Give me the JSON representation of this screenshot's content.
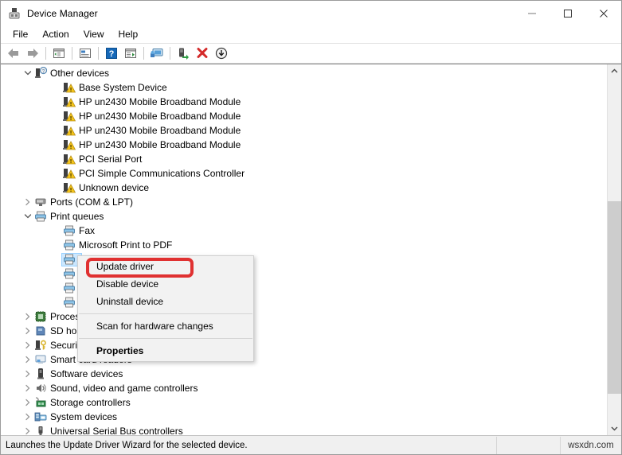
{
  "window": {
    "title": "Device Manager",
    "icon": "device-manager-icon",
    "controls": {
      "minimize": "minimize-icon",
      "maximize": "maximize-icon",
      "close": "close-icon"
    }
  },
  "menubar": {
    "items": [
      {
        "label": "File"
      },
      {
        "label": "Action"
      },
      {
        "label": "View"
      },
      {
        "label": "Help"
      }
    ]
  },
  "toolbar": {
    "buttons": [
      {
        "name": "back-icon",
        "tip": "Back"
      },
      {
        "name": "forward-icon",
        "tip": "Forward"
      },
      {
        "name": "show-hide-console-tree-icon",
        "tip": "Show/Hide Console Tree"
      },
      {
        "name": "properties-icon",
        "tip": "Properties"
      },
      {
        "name": "help-icon",
        "tip": "Help"
      },
      {
        "name": "update-driver-icon",
        "tip": "Update driver"
      },
      {
        "name": "scan-for-hardware-changes-icon",
        "tip": "Scan for hardware changes"
      },
      {
        "name": "enable-device-icon",
        "tip": "Enable device"
      },
      {
        "name": "uninstall-device-icon",
        "tip": "Uninstall device"
      },
      {
        "name": "disable-device-icon",
        "tip": "Disable device"
      }
    ]
  },
  "tree": {
    "rows": [
      {
        "label": "Other devices",
        "icon": "unknown-device-category-icon",
        "level": 1,
        "expander": "expanded",
        "selected": false
      },
      {
        "label": "Base System Device",
        "icon": "warning-device-icon",
        "level": 2,
        "expander": "none",
        "selected": false
      },
      {
        "label": "HP un2430 Mobile Broadband Module",
        "icon": "warning-device-icon",
        "level": 2,
        "expander": "none",
        "selected": false
      },
      {
        "label": "HP un2430 Mobile Broadband Module",
        "icon": "warning-device-icon",
        "level": 2,
        "expander": "none",
        "selected": false
      },
      {
        "label": "HP un2430 Mobile Broadband Module",
        "icon": "warning-device-icon",
        "level": 2,
        "expander": "none",
        "selected": false
      },
      {
        "label": "HP un2430 Mobile Broadband Module",
        "icon": "warning-device-icon",
        "level": 2,
        "expander": "none",
        "selected": false
      },
      {
        "label": "PCI Serial Port",
        "icon": "warning-device-icon",
        "level": 2,
        "expander": "none",
        "selected": false
      },
      {
        "label": "PCI Simple Communications Controller",
        "icon": "warning-device-icon",
        "level": 2,
        "expander": "none",
        "selected": false
      },
      {
        "label": "Unknown device",
        "icon": "warning-device-icon",
        "level": 2,
        "expander": "none",
        "selected": false
      },
      {
        "label": "Ports (COM & LPT)",
        "icon": "ports-icon",
        "level": 1,
        "expander": "collapsed",
        "selected": false
      },
      {
        "label": "Print queues",
        "icon": "printer-icon",
        "level": 1,
        "expander": "expanded",
        "selected": false
      },
      {
        "label": "Fax",
        "icon": "printer-icon",
        "level": 2,
        "expander": "none",
        "selected": false
      },
      {
        "label": "Microsoft Print to PDF",
        "icon": "printer-icon",
        "level": 2,
        "expander": "none",
        "selected": false
      },
      {
        "label": "",
        "icon": "printer-icon",
        "level": 2,
        "expander": "none",
        "selected": true
      },
      {
        "label": "",
        "icon": "printer-icon",
        "level": 2,
        "expander": "none",
        "selected": false
      },
      {
        "label": "",
        "icon": "printer-icon",
        "level": 2,
        "expander": "none",
        "selected": false
      },
      {
        "label": "",
        "icon": "printer-icon",
        "level": 2,
        "expander": "none",
        "selected": false
      },
      {
        "label": "Processors",
        "icon": "processor-icon",
        "level": 1,
        "expander": "collapsed",
        "selected": false
      },
      {
        "label": "SD host adapters",
        "icon": "sd-host-adapter-icon",
        "level": 1,
        "expander": "collapsed",
        "selected": false
      },
      {
        "label": "Security devices",
        "icon": "security-device-icon",
        "level": 1,
        "expander": "collapsed",
        "selected": false
      },
      {
        "label": "Smart card readers",
        "icon": "smart-card-reader-icon",
        "level": 1,
        "expander": "collapsed",
        "selected": false
      },
      {
        "label": "Software devices",
        "icon": "software-device-icon",
        "level": 1,
        "expander": "collapsed",
        "selected": false
      },
      {
        "label": "Sound, video and game controllers",
        "icon": "sound-controller-icon",
        "level": 1,
        "expander": "collapsed",
        "selected": false
      },
      {
        "label": "Storage controllers",
        "icon": "storage-controller-icon",
        "level": 1,
        "expander": "collapsed",
        "selected": false
      },
      {
        "label": "System devices",
        "icon": "system-device-icon",
        "level": 1,
        "expander": "collapsed",
        "selected": false
      },
      {
        "label": "Universal Serial Bus controllers",
        "icon": "usb-controller-icon",
        "level": 1,
        "expander": "collapsed",
        "selected": false
      }
    ]
  },
  "context_menu": {
    "items": [
      {
        "label": "Update driver",
        "bold": false,
        "highlighted": true
      },
      {
        "label": "Disable device",
        "bold": false,
        "highlighted": false
      },
      {
        "label": "Uninstall device",
        "bold": false,
        "highlighted": false
      },
      {
        "separator": true
      },
      {
        "label": "Scan for hardware changes",
        "bold": false,
        "highlighted": false
      },
      {
        "separator": true
      },
      {
        "label": "Properties",
        "bold": true,
        "highlighted": false
      }
    ],
    "highlight_color": "#e03131"
  },
  "statusbar": {
    "message": "Launches the Update Driver Wizard for the selected device.",
    "middle": "",
    "watermark": "wsxdn.com"
  },
  "scrollbar": {
    "up_arrow": "scroll-up-icon",
    "down_arrow": "scroll-down-icon"
  }
}
